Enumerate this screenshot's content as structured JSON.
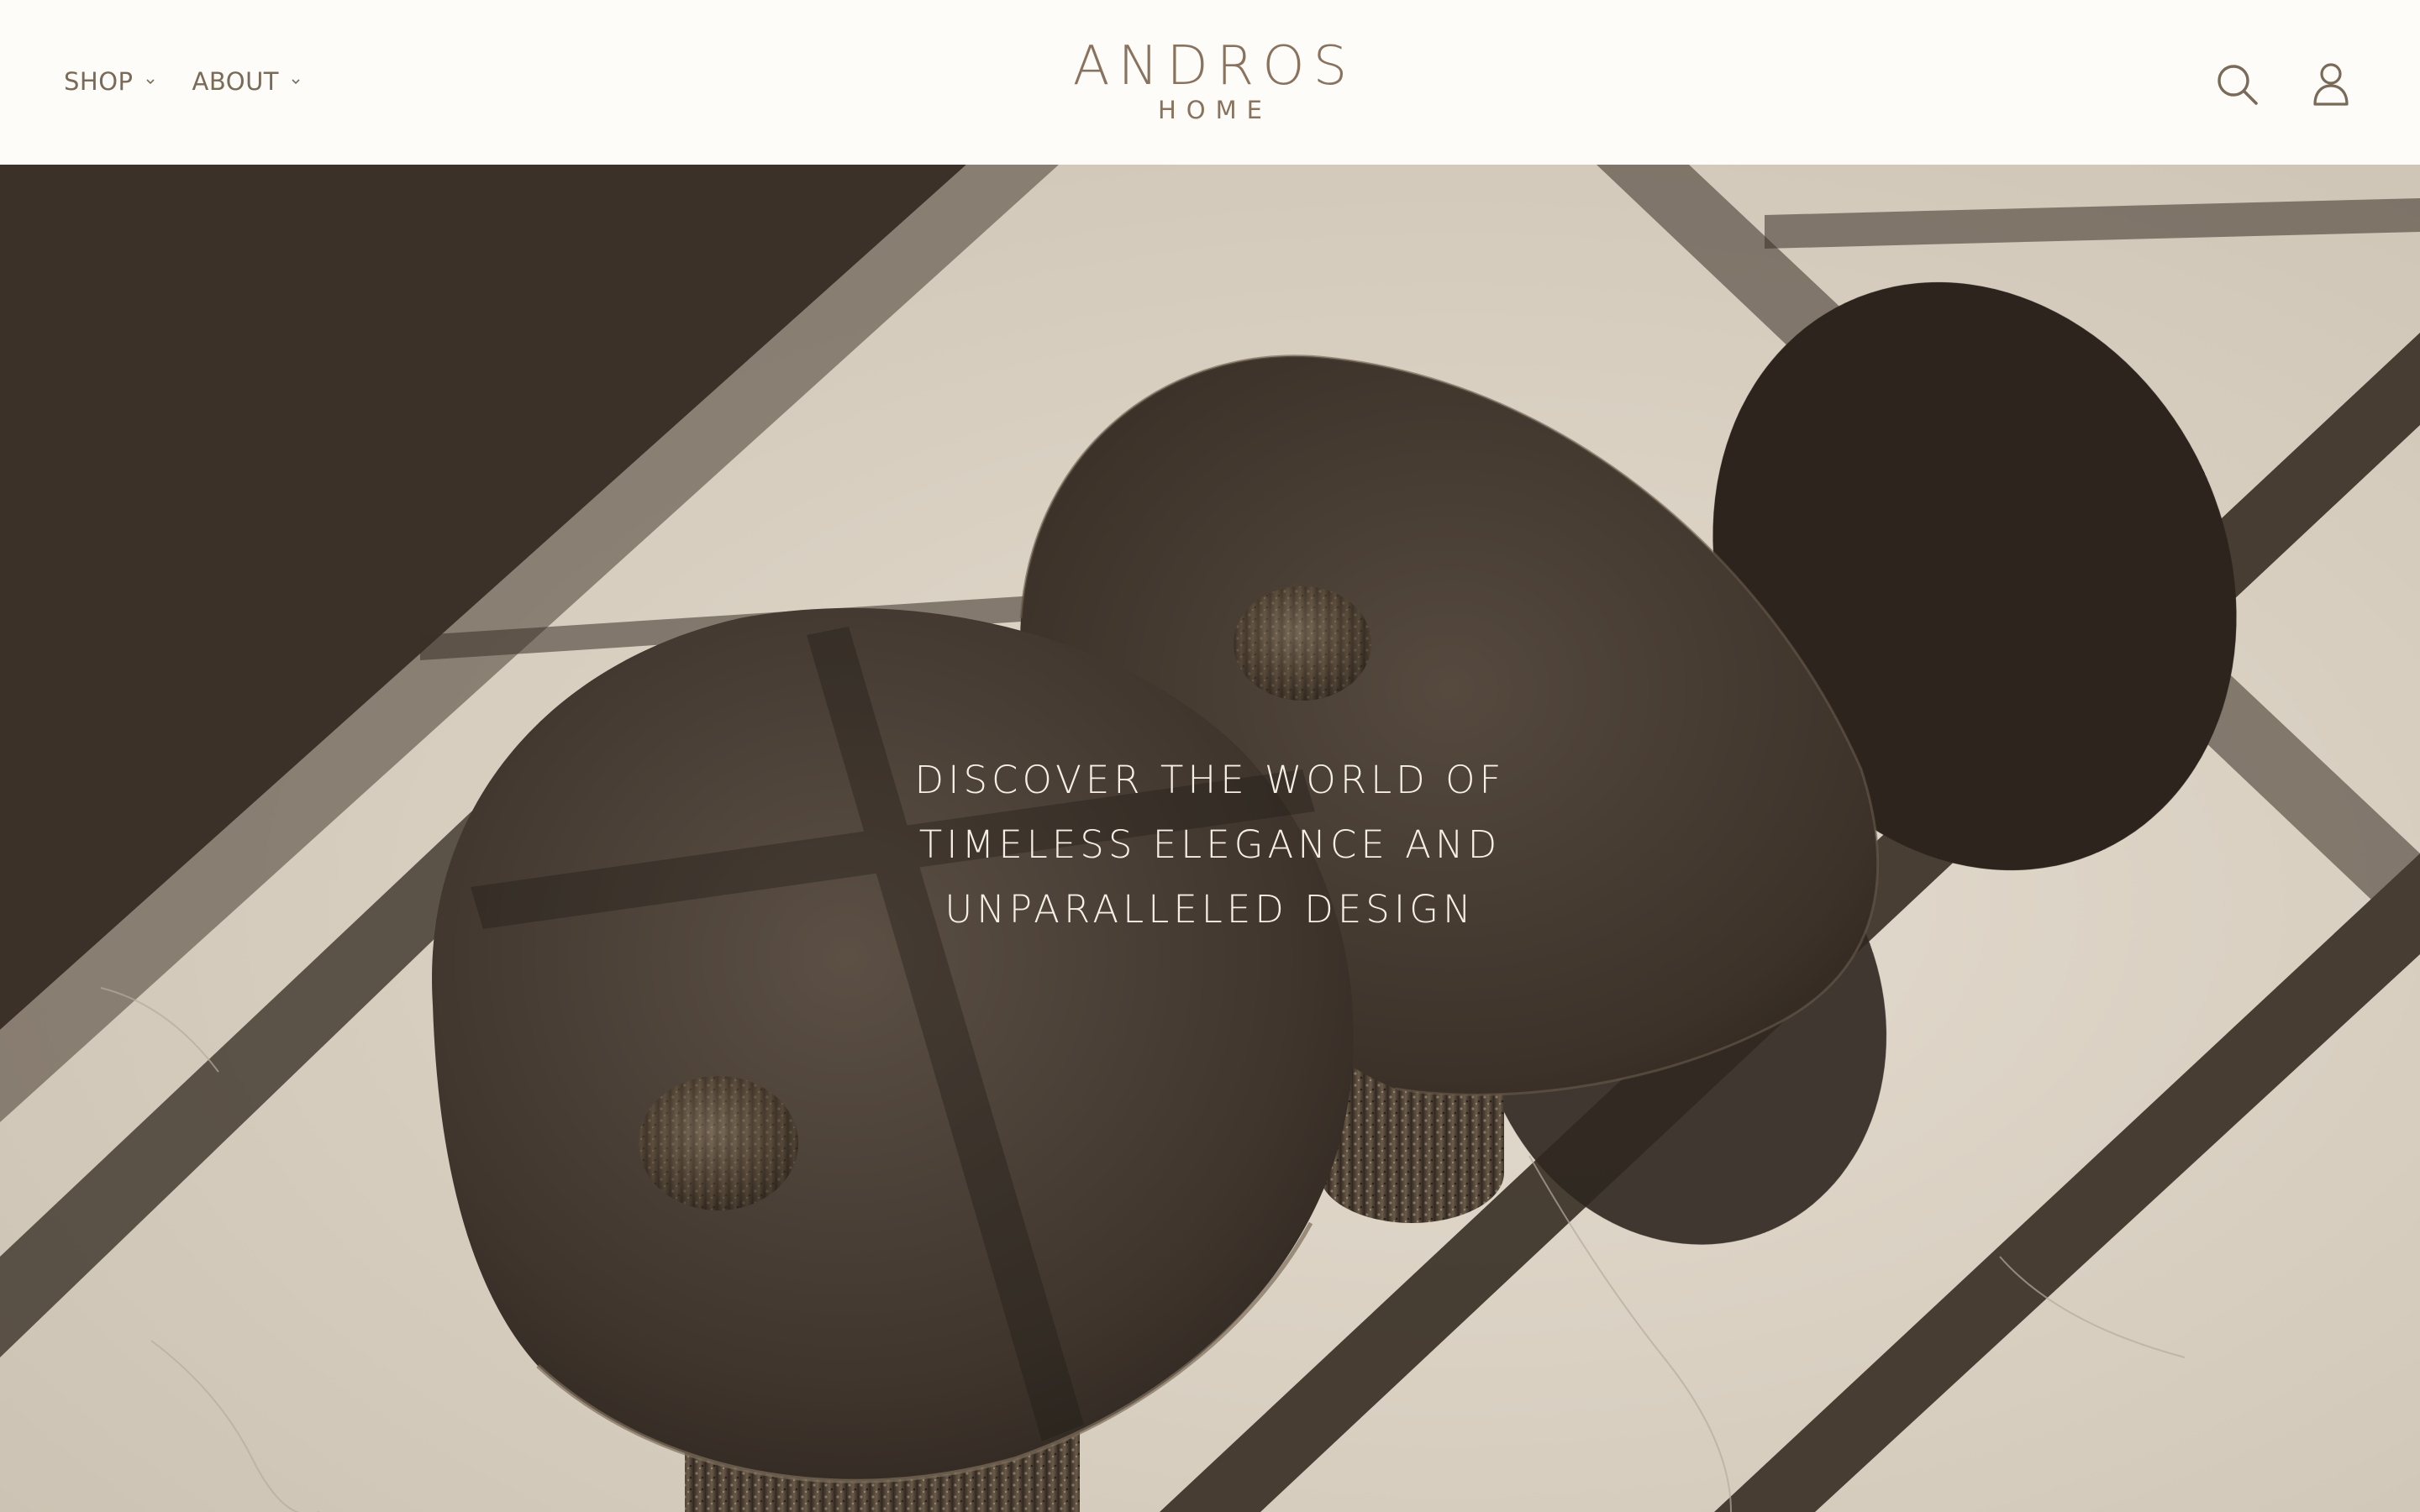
{
  "header": {
    "nav": [
      {
        "label": "SHOP"
      },
      {
        "label": "ABOUT"
      }
    ],
    "logo": {
      "main": "ANDROS",
      "sub": "HOME"
    },
    "icons": [
      "search-icon",
      "account-icon"
    ]
  },
  "hero": {
    "lines": [
      "DISCOVER THE WORLD OF",
      "TIMELESS ELEGANCE AND",
      "UNPARALLELED DESIGN"
    ]
  },
  "colors": {
    "header_bg": "#fdfcf9",
    "brand_text": "#8a735e",
    "hero_text": "#f5efe6"
  }
}
